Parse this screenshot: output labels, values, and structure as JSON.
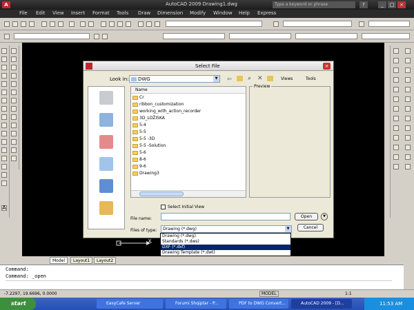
{
  "app": {
    "title": "AutoCAD 2009   Drawing1.dwg",
    "search_placeholder": "Type a keyword or phrase",
    "logo": "A"
  },
  "menu": [
    "File",
    "Edit",
    "View",
    "Insert",
    "Format",
    "Tools",
    "Draw",
    "Dimension",
    "Modify",
    "Window",
    "Help",
    "Express"
  ],
  "dialog": {
    "title": "Select File",
    "look_in_label": "Look in:",
    "look_in_value": "DWG",
    "views_label": "Views",
    "tools_label": "Tools",
    "column_name": "Name",
    "files": [
      "Cr",
      "ribbon_customization",
      "working_with_action_recorder",
      "3D_LOŽISKA",
      "5-4",
      "5-5",
      "5-5 -3D",
      "5-5 -Solution",
      "5-6",
      "8-6",
      "9-6",
      "Drawing3"
    ],
    "preview_label": "Preview",
    "select_initial_view": "Select Initial View",
    "file_name_label": "File name:",
    "file_name_value": "",
    "files_of_type_label": "Files of type:",
    "files_of_type_value": "Drawing (*.dwg)",
    "open_button": "Open",
    "cancel_button": "Cancel",
    "type_options": [
      "Drawing (*.dwg)",
      "Standards (*.dws)",
      "DXF (*.dxf)",
      "Drawing Template (*.dwt)"
    ],
    "selected_type_index": 2
  },
  "tabs": [
    "Model",
    "Layout1",
    "Layout2"
  ],
  "command": {
    "line1": "Command:",
    "line2": "Command: _open"
  },
  "status": {
    "coords": "-7.2297, 19.6696, 0.0000",
    "model": "MODEL",
    "scale": "1:1"
  },
  "taskbar": {
    "start": "start",
    "items": [
      "EasyCafe Server",
      "Forumi Shqiptar - P...",
      "PDF to DWG Convert...",
      "AutoCAD 2009 - [D..."
    ],
    "clock": "11:53 AM"
  },
  "canvas_label": "X",
  "colors": {
    "canvas": "#000000",
    "selection": "#0a246a",
    "taskbar": "#2450b8"
  }
}
